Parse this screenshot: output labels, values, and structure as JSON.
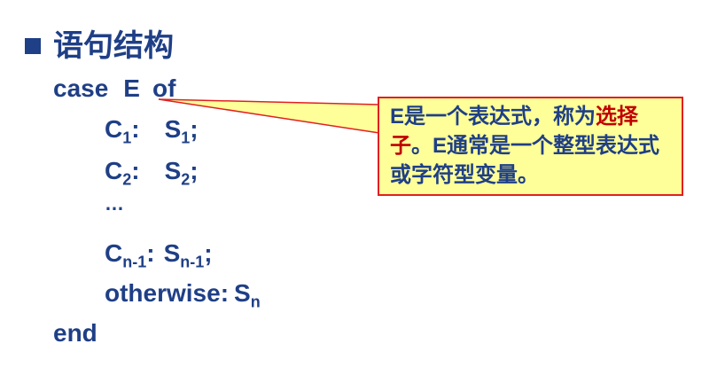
{
  "heading": "语句结构",
  "code": {
    "line1": {
      "keyword": "case",
      "selector": "E",
      "of": "of"
    },
    "line2": {
      "c": "C",
      "c_sub": "1",
      "sep": ":",
      "s": "S",
      "s_sub": "1",
      "end": ";"
    },
    "line3": {
      "c": "C",
      "c_sub": "2",
      "sep": ":",
      "s": "S",
      "s_sub": "2",
      "end": ";"
    },
    "ellipsis": "…",
    "line4": {
      "c": "C",
      "c_sub": "n-1",
      "sep": ":",
      "s": "S",
      "s_sub": "n-1",
      "end": ";"
    },
    "line5": {
      "keyword": "otherwise",
      "sep": ":",
      "s": "S",
      "s_sub": "n"
    },
    "line6": {
      "keyword": "end"
    }
  },
  "callout": {
    "part1": "E是一个表达式，称为",
    "highlight": "选择子",
    "part2": "。E通常是一个整型表达式或字符型变量。"
  },
  "colors": {
    "text": "#1f3f86",
    "callout_bg": "#ffff99",
    "callout_border": "#e02020",
    "highlight": "#c00000"
  }
}
